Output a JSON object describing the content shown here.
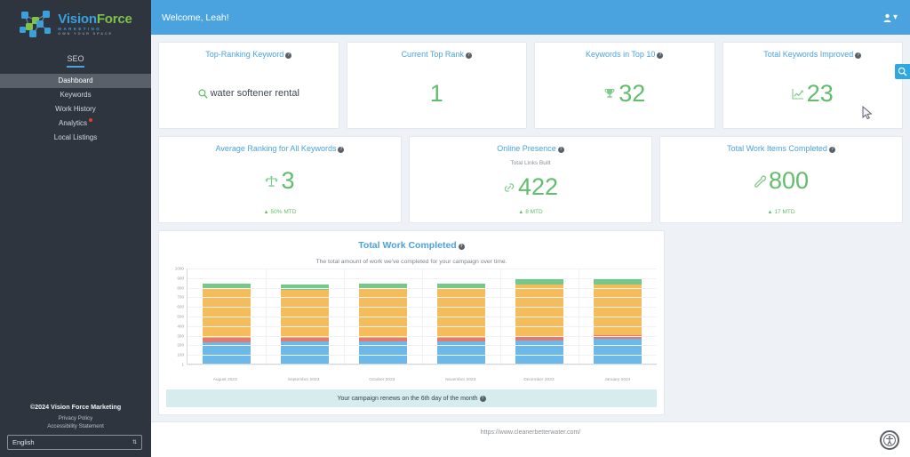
{
  "sidebar": {
    "logo": {
      "name_part1": "Vision",
      "name_part2": "Force",
      "tagline1": "MARKETING",
      "tagline2": "OWN YOUR SPACE"
    },
    "section_tab": "SEO",
    "items": [
      {
        "label": "Dashboard",
        "active": true,
        "badge": false
      },
      {
        "label": "Keywords",
        "active": false,
        "badge": false
      },
      {
        "label": "Work History",
        "active": false,
        "badge": false
      },
      {
        "label": "Analytics",
        "active": false,
        "badge": true
      },
      {
        "label": "Local Listings",
        "active": false,
        "badge": false
      }
    ],
    "footer": {
      "copyright": "©2024 Vision Force Marketing",
      "privacy_policy": "Privacy Policy",
      "accessibility_statement": "Accessibility Statement",
      "language_value": "English"
    }
  },
  "header": {
    "welcome": "Welcome, Leah!",
    "user_icon": "user-icon",
    "caret": "▾"
  },
  "kpi_row1": [
    {
      "title": "Top-Ranking Keyword",
      "icon": "search-icon",
      "value": "water softener rental",
      "value_type": "text"
    },
    {
      "title": "Current Top Rank",
      "icon": "",
      "value": "1",
      "value_type": "number"
    },
    {
      "title": "Keywords in Top 10",
      "icon": "trophy-icon",
      "value": "32",
      "value_type": "number"
    },
    {
      "title": "Total Keywords Improved",
      "icon": "line-chart-icon",
      "value": "23",
      "value_type": "number"
    }
  ],
  "kpi_row2": [
    {
      "title": "Average Ranking for All Keywords",
      "sub_label": "",
      "icon": "scales-icon",
      "value": "3",
      "mtd": "50% MTD"
    },
    {
      "title": "Online Presence",
      "sub_label": "Total Links Built",
      "icon": "link-icon",
      "value": "422",
      "mtd": "8 MTD"
    },
    {
      "title": "Total Work Items Completed",
      "sub_label": "",
      "icon": "wrench-icon",
      "value": "800",
      "mtd": "17 MTD"
    }
  ],
  "chart_card": {
    "title": "Total Work Completed",
    "subtitle": "The total amount of work we've completed for your campaign over time.",
    "renew_banner": "Your campaign renews on the 6th day of the month"
  },
  "chart_data": {
    "type": "bar",
    "stacked": true,
    "title": "Total Work Completed",
    "subtitle": "The total amount of work we've completed for your campaign over time.",
    "xlabel": "",
    "ylabel": "",
    "ylim": [
      1,
      1000
    ],
    "grid": true,
    "legend": "none",
    "ytick_labels": [
      "1",
      "100",
      "200",
      "300",
      "400",
      "500",
      "600",
      "700",
      "800",
      "900",
      "1000"
    ],
    "ytick_values": [
      1,
      100,
      200,
      300,
      400,
      500,
      600,
      700,
      800,
      900,
      1000
    ],
    "categories": [
      "August 2023",
      "September 2023",
      "October 2023",
      "November 2023",
      "December 2023",
      "January 2024"
    ],
    "series": [
      {
        "name": "series-blue",
        "color": "#6cb8e8",
        "values": [
          220,
          230,
          230,
          235,
          245,
          255
        ]
      },
      {
        "name": "series-red",
        "color": "#e8786b",
        "values": [
          50,
          35,
          40,
          35,
          35,
          45
        ]
      },
      {
        "name": "series-orange",
        "color": "#f5bc5c",
        "values": [
          505,
          500,
          505,
          505,
          540,
          525
        ]
      },
      {
        "name": "series-green",
        "color": "#76c88a",
        "values": [
          60,
          55,
          60,
          55,
          65,
          55
        ]
      }
    ]
  },
  "footer": {
    "url": "https://www.cleanerbetterwater.com/"
  },
  "widgets": {
    "search_tab_icon": "search-zoom-icon",
    "accessibility_icon": "accessibility-person-icon"
  },
  "colors": {
    "brand_blue": "#4aa3df",
    "accent_green": "#62bd6d",
    "sidebar_bg": "#2f353f",
    "page_bg": "#eef2f7",
    "bar_blue": "#6cb8e8",
    "bar_red": "#e8786b",
    "bar_orange": "#f5bc5c",
    "bar_green": "#76c88a",
    "badge_red": "#e8402a",
    "banner_bg": "#d6ecef"
  }
}
